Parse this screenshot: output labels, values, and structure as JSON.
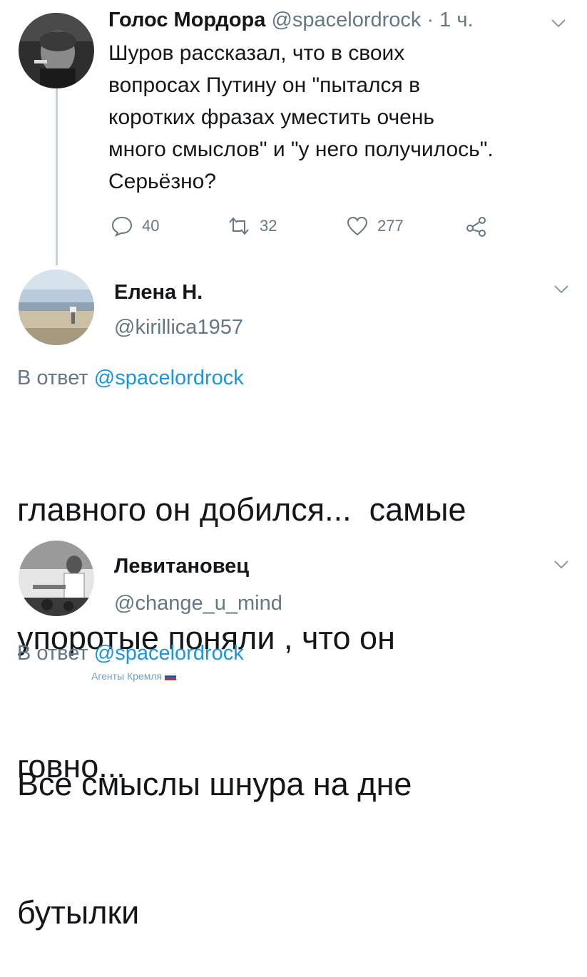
{
  "tweet1": {
    "display_name": "Голос Мордора",
    "handle": "@spacelordrock",
    "time": "· 1 ч.",
    "text_lines": [
      "Шуров рассказал, что в своих",
      "вопросах Путину он \"пытался в",
      "коротких фразах уместить очень",
      "много смыслов\" и \"у него получилось\".",
      "Серьёзно?"
    ],
    "replies": "40",
    "retweets": "32",
    "likes": "277"
  },
  "reply1": {
    "display_name": "Елена Н.",
    "handle": "@kirillica1957",
    "reply_to_prefix": "В ответ",
    "reply_to_handle": "@spacelordrock",
    "text_lines": [
      "главного он добился...  самые",
      "упоротые поняли , что он",
      "говно..."
    ]
  },
  "reply2": {
    "display_name": "Левитановец",
    "handle": "@change_u_mind",
    "reply_to_prefix": "В ответ",
    "reply_to_handle": "@spacelordrock",
    "watermark": "Агенты Кремля",
    "text_lines": [
      "Все смыслы шнура на дне",
      "бутылки"
    ]
  },
  "icons": {
    "reply": "reply-icon",
    "retweet": "retweet-icon",
    "like": "heart-icon",
    "share": "share-icon",
    "menu": "chevron-down-icon"
  },
  "colors": {
    "text": "#14171a",
    "muted": "#657786",
    "link": "#1b95e0",
    "thread_line": "#c4cfd6"
  }
}
